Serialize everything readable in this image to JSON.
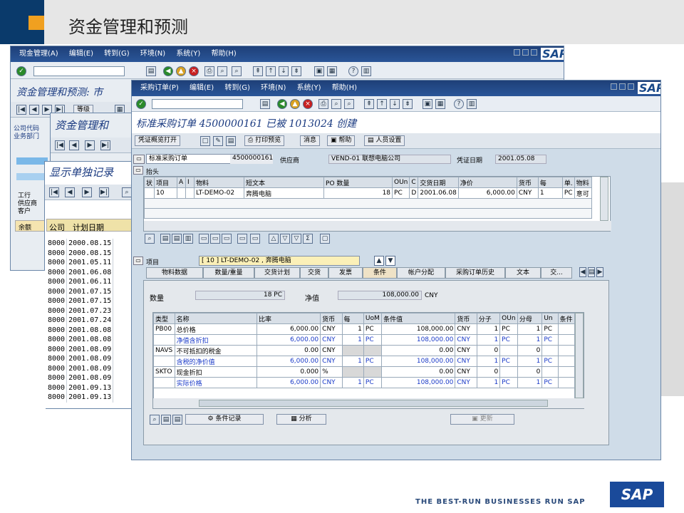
{
  "slide": {
    "title": "资金管理和预测"
  },
  "win1": {
    "menu": [
      "现金管理(A)",
      "编辑(E)",
      "转到(G)",
      "环境(N)",
      "系统(Y)",
      "帮助(H)"
    ],
    "title": "资金管理和预测:",
    "title_suffix": "市",
    "btn_level": "等级",
    "labels": [
      "公司代码",
      "业务部门"
    ],
    "left_labels": [
      "工行",
      "供应商",
      "客户"
    ],
    "balance_label": "余额"
  },
  "win2": {
    "title": "资金管理和"
  },
  "win3": {
    "title": "显示单独记录",
    "col_company": "公司",
    "col_date": "计划日期",
    "rows": [
      [
        "8000",
        "2000.08.15"
      ],
      [
        "8000",
        "2000.08.15"
      ],
      [
        "8000",
        "2001.05.11"
      ],
      [
        "8000",
        "2001.06.08"
      ],
      [
        "8000",
        "2001.06.11"
      ],
      [
        "8000",
        "2001.07.15"
      ],
      [
        "8000",
        "2001.07.15"
      ],
      [
        "8000",
        "2001.07.23"
      ],
      [
        "8000",
        "2001.07.24"
      ],
      [
        "8000",
        "2001.08.08"
      ],
      [
        "8000",
        "2001.08.08"
      ],
      [
        "8000",
        "2001.08.09"
      ],
      [
        "8000",
        "2001.08.09"
      ],
      [
        "8000",
        "2001.08.09"
      ],
      [
        "8000",
        "2001.08.09"
      ],
      [
        "8000",
        "2001.09.13"
      ],
      [
        "8000",
        "2001.09.13"
      ]
    ]
  },
  "po": {
    "menu": [
      "采购订单(P)",
      "编辑(E)",
      "转到(G)",
      "环境(N)",
      "系统(Y)",
      "帮助(H)"
    ],
    "title": "标准采购订单 4500000161 已被 1013024 创建",
    "toolbar": [
      "凭证概览打开",
      "打印预览",
      "消息",
      "帮助",
      "人员设置"
    ],
    "doc_type": "标准采购订单",
    "doc_number": "4500000161",
    "vendor_label": "供应商",
    "vendor_value": "VEND-01 联想电脑公司",
    "date_label": "凭证日期",
    "date_value": "2001.05.08",
    "header_label": "抬头",
    "item_cols": [
      "状",
      "项目",
      "A",
      "I",
      "物料",
      "短文本",
      "PO 数量",
      "OUn",
      "C",
      "交货日期",
      "净价",
      "货币",
      "每",
      "单.",
      "物料"
    ],
    "item_row": [
      "",
      "10",
      "",
      "",
      "LT-DEMO-02",
      "奔腾电脑",
      "18",
      "PC",
      "D",
      "2001.06.08",
      "6,000.00",
      "CNY",
      "1",
      "PC",
      "意可"
    ],
    "item_label": "项目",
    "item_select": "[ 10 ] LT-DEMO-02 , 奔腾电脑",
    "tabs": [
      "物料数据",
      "数量/重量",
      "交货计划",
      "交货",
      "发票",
      "条件",
      "帐户分配",
      "采购订单历史",
      "文本",
      "交..."
    ],
    "active_tab": "条件",
    "qty_label": "数量",
    "qty_value": "18 PC",
    "net_label": "净值",
    "net_value": "108,000.00",
    "net_currency": "CNY",
    "cond_cols": [
      "类型",
      "名称",
      "比率",
      "货币",
      "每",
      "UoM",
      "条件值",
      "货币",
      "分子",
      "OUn",
      "分母",
      "Un",
      "条件"
    ],
    "cond_rows": [
      {
        "type": "PB00",
        "name": "总价格",
        "rate": "6,000.00",
        "cur": "CNY",
        "per": "1",
        "uom": "PC",
        "val": "108,000.00",
        "cur2": "CNY",
        "num": "1",
        "oun": "PC",
        "den": "1",
        "un": "PC",
        "blue": false
      },
      {
        "type": "",
        "name": "净值含折扣",
        "rate": "6,000.00",
        "cur": "CNY",
        "per": "1",
        "uom": "PC",
        "val": "108,000.00",
        "cur2": "CNY",
        "num": "1",
        "oun": "PC",
        "den": "1",
        "un": "PC",
        "blue": true
      },
      {
        "type": "NAVS",
        "name": "不可抵扣的税金",
        "rate": "0.00",
        "cur": "CNY",
        "per": "",
        "uom": "",
        "val": "0.00",
        "cur2": "CNY",
        "num": "0",
        "oun": "",
        "den": "0",
        "un": "",
        "blue": false
      },
      {
        "type": "",
        "name": "含税的净价值",
        "rate": "6,000.00",
        "cur": "CNY",
        "per": "1",
        "uom": "PC",
        "val": "108,000.00",
        "cur2": "CNY",
        "num": "1",
        "oun": "PC",
        "den": "1",
        "un": "PC",
        "blue": true
      },
      {
        "type": "SKTO",
        "name": "现金折扣",
        "rate": "0.000",
        "cur": "%",
        "per": "",
        "uom": "",
        "val": "0.00",
        "cur2": "CNY",
        "num": "0",
        "oun": "",
        "den": "0",
        "un": "",
        "blue": false
      },
      {
        "type": "",
        "name": "实际价格",
        "rate": "6,000.00",
        "cur": "CNY",
        "per": "1",
        "uom": "PC",
        "val": "108,000.00",
        "cur2": "CNY",
        "num": "1",
        "oun": "PC",
        "den": "1",
        "un": "PC",
        "blue": true
      }
    ],
    "btn_cond_record": "条件记录",
    "btn_analysis": "分析",
    "btn_update": "更新"
  },
  "footer": {
    "tagline": "THE BEST-RUN BUSINESSES RUN SAP",
    "logo": "SAP"
  },
  "sap_small": "SAP"
}
